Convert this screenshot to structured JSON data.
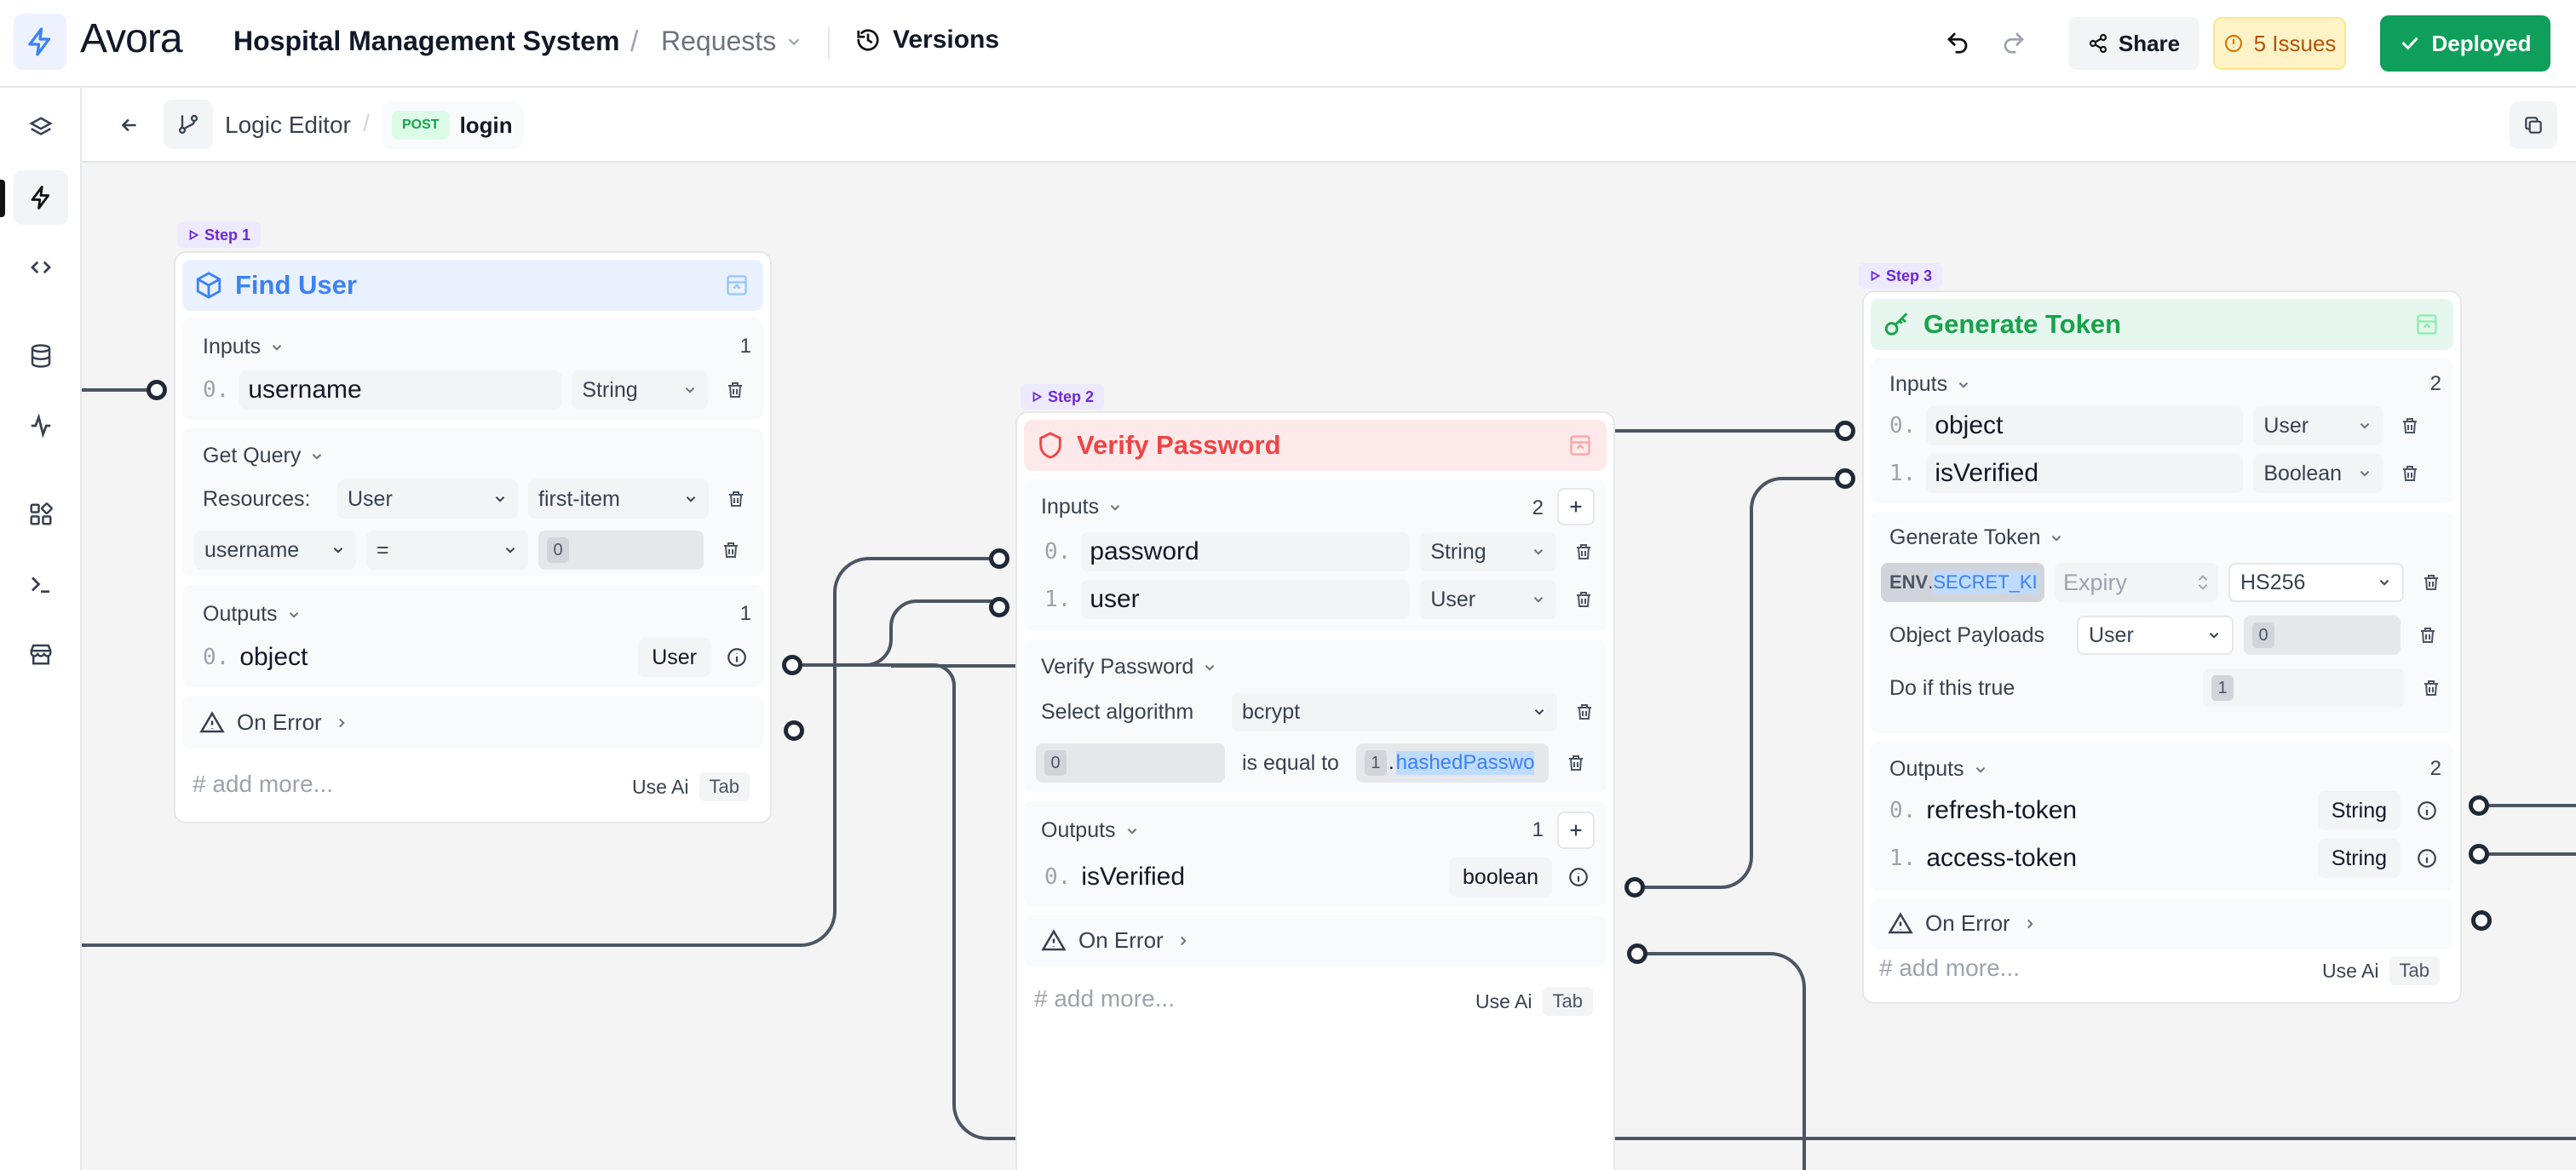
{
  "app": {
    "logo_text": "Avora",
    "project_title": "Hospital Management System",
    "crumb_sep": "/",
    "page": "Requests",
    "versions": "Versions"
  },
  "toolbar": {
    "share": "Share",
    "issues": "5 Issues",
    "deployed": "Deployed"
  },
  "subbar": {
    "editor": "Logic Editor",
    "sep": "/",
    "method": "POST",
    "route": "login"
  },
  "rail": {
    "items": [
      "layers",
      "logic",
      "code",
      "database",
      "activity",
      "components",
      "terminal",
      "store"
    ]
  },
  "common": {
    "add_more": "# add more...",
    "use_ai": "Use Ai",
    "tab": "Tab",
    "on_error": "On Error",
    "inputs": "Inputs",
    "outputs": "Outputs",
    "trash": "",
    "info": ""
  },
  "step1": {
    "tag": "Step 1",
    "title": "Find User",
    "inputs_count": "1",
    "input0": {
      "idx": "0.",
      "name": "username",
      "type": "String"
    },
    "query_label": "Get Query",
    "resources_label": "Resources:",
    "resource": "User",
    "mode": "first-item",
    "cond_field": "username",
    "cond_op": "=",
    "cond_value": "0",
    "outputs_count": "1",
    "output0": {
      "idx": "0.",
      "name": "object",
      "type": "User"
    }
  },
  "step2": {
    "tag": "Step 2",
    "title": "Verify Password",
    "inputs_count": "2",
    "input0": {
      "idx": "0.",
      "name": "password",
      "type": "String"
    },
    "input1": {
      "idx": "1.",
      "name": "user",
      "type": "User"
    },
    "verify_label": "Verify Password",
    "algo_label": "Select algorithm",
    "algo": "bcrypt",
    "left_token": "0",
    "equal_label": "is equal to",
    "right_token": "1",
    "right_dot": ".",
    "right_prop": "hashedPasswo",
    "outputs_count": "1",
    "output0": {
      "idx": "0.",
      "name": "isVerified",
      "type": "boolean"
    }
  },
  "step3": {
    "tag": "Step 3",
    "title": "Generate Token",
    "inputs_count": "2",
    "input0": {
      "idx": "0.",
      "name": "object",
      "type": "User"
    },
    "input1": {
      "idx": "1.",
      "name": "isVerified",
      "type": "Boolean"
    },
    "gen_label": "Generate Token",
    "env_prefix": "ENV",
    "env_dot": ".",
    "env_key": "SECRET_KI",
    "expiry_placeholder": "Expiry",
    "algo": "HS256",
    "payload_label": "Object Payloads",
    "payload_type": "User",
    "payload_token": "0",
    "if_label": "Do if this true",
    "if_token": "1",
    "outputs_count": "2",
    "output0": {
      "idx": "0.",
      "name": "refresh-token",
      "type": "String"
    },
    "output1": {
      "idx": "1.",
      "name": "access-token",
      "type": "String"
    }
  },
  "colors": {
    "accent": "#3b82f6",
    "deployed": "#0f9f5a",
    "issues": "#b45309",
    "step1_header": "#eaf1fe",
    "step2_header": "#fde8ea",
    "step3_header": "#e6f6ee"
  }
}
